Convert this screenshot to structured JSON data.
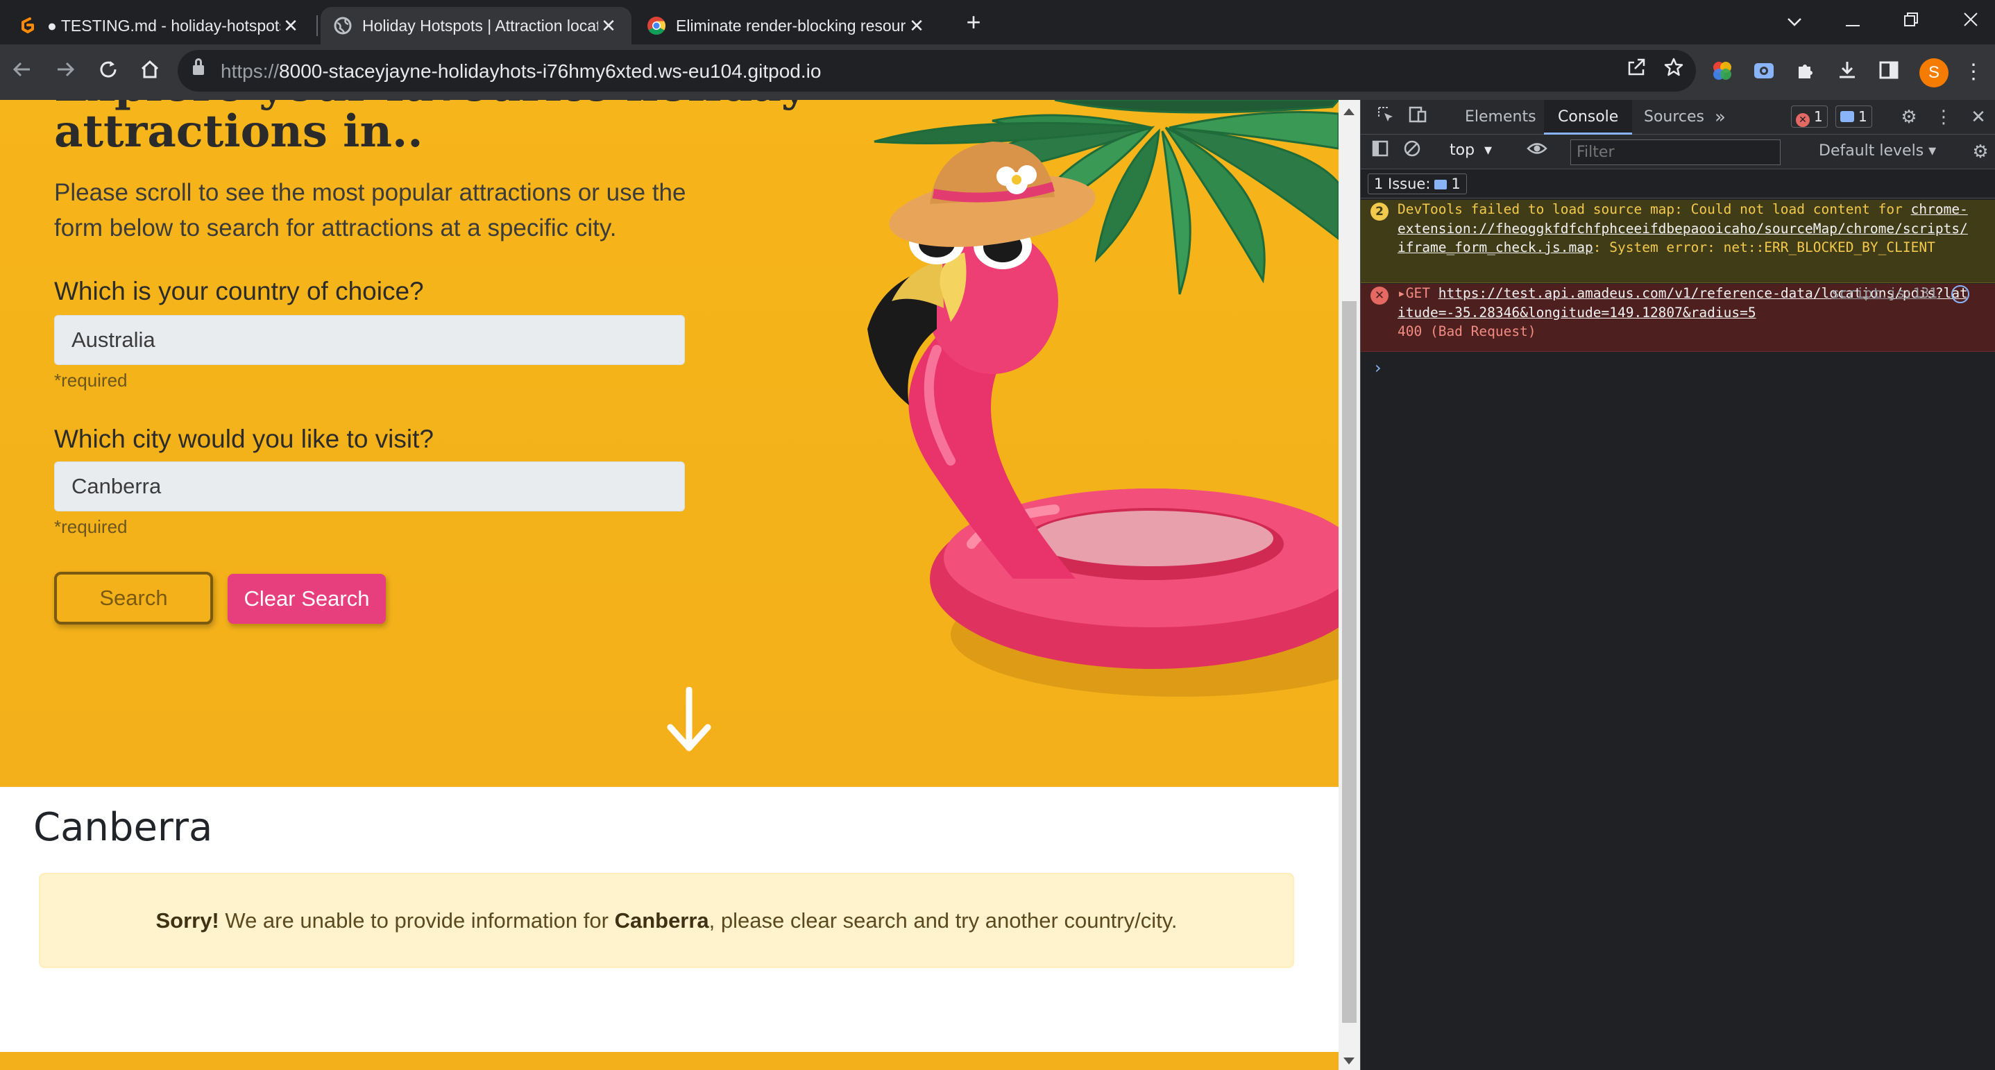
{
  "browser": {
    "tabs": [
      {
        "title": "● TESTING.md - holiday-hotspots",
        "icon": "gitpod-icon",
        "active": false
      },
      {
        "title": "Holiday Hotspots | Attraction locator",
        "icon": "globe-icon",
        "active": true
      },
      {
        "title": "Eliminate render-blocking resources",
        "icon": "chrome-icon",
        "active": false
      }
    ],
    "url_scheme": "https://",
    "url_host": "8000-staceyjayne-holidayhots-i76hmy6xted.ws-eu104.gitpod.io",
    "profile_initial": "S",
    "colors": {
      "chrome_bg": "#202124",
      "toolbar_bg": "#35363a",
      "profile": "#f57c00"
    }
  },
  "page": {
    "heading_cut": "Explore your favourite holiday",
    "heading": "attractions in..",
    "intro": "Please scroll to see the most popular attractions or use the form below to search for attractions at a specific city.",
    "country_label": "Which is your country of choice?",
    "country_value": "Australia",
    "city_label": "Which city would you like to visit?",
    "city_value": "Canberra",
    "required_note": "*required",
    "search_button": "Search",
    "clear_button": "Clear Search",
    "result_city": "Canberra",
    "alert_sorry": "Sorry!",
    "alert_text_1": " We are unable to provide information for ",
    "alert_city": "Canberra",
    "alert_text_2": ", please clear search and try another country/city.",
    "colors": {
      "hero_bg": "#f6b51a",
      "clear_btn": "#e73e7e",
      "alert_bg": "#fff3cd"
    }
  },
  "devtools": {
    "tabs": [
      "Elements",
      "Console",
      "Sources"
    ],
    "active_tab": "Console",
    "error_count": "1",
    "message_count": "1",
    "context": "top",
    "filter_placeholder": "Filter",
    "levels": "Default levels",
    "issues_label": "1 Issue:",
    "issues_count": "1",
    "warning": {
      "count": "2",
      "text_1": "DevTools failed to load source map: Could not load content for ",
      "link": "chrome-extension://fheoggkfdfchfphceeifdbepaooicaho/sourceMap/chrome/scripts/iframe_form_check.js.map",
      "text_2": ": System error: net::ERR_BLOCKED_BY_CLIENT"
    },
    "error": {
      "method": "GET",
      "url": "https://test.api.amadeus.com/v1/reference-data/locations/pois?latitude=-35.28346&longitude=149.12807&radius=5",
      "source": "script.js:131",
      "status": "400 (Bad Request)"
    }
  }
}
